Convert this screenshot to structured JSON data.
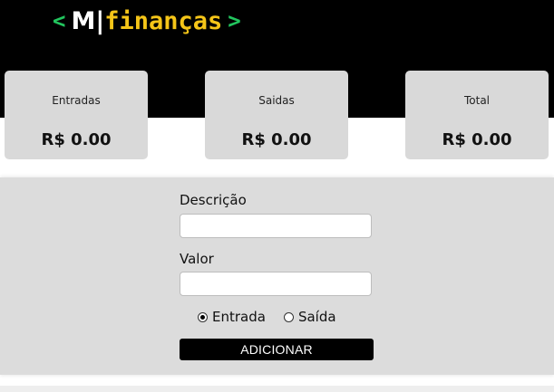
{
  "header": {
    "logo": {
      "left_bracket": "<",
      "letter": "M",
      "separator": "|",
      "name": "finanças",
      "right_bracket": ">"
    },
    "colors": {
      "background": "#000000",
      "bracket": "#22c55e",
      "name": "#f5c518"
    }
  },
  "summary": {
    "income": {
      "label": "Entradas",
      "value": "R$ 0.00"
    },
    "expense": {
      "label": "Saidas",
      "value": "R$ 0.00"
    },
    "total": {
      "label": "Total",
      "value": "R$ 0.00"
    }
  },
  "form": {
    "description_label": "Descrição",
    "description_value": "",
    "amount_label": "Valor",
    "amount_value": "",
    "type_options": [
      {
        "label": "Entrada",
        "checked": true
      },
      {
        "label": "Saída",
        "checked": false
      }
    ],
    "submit_label": "ADICIONAR"
  }
}
